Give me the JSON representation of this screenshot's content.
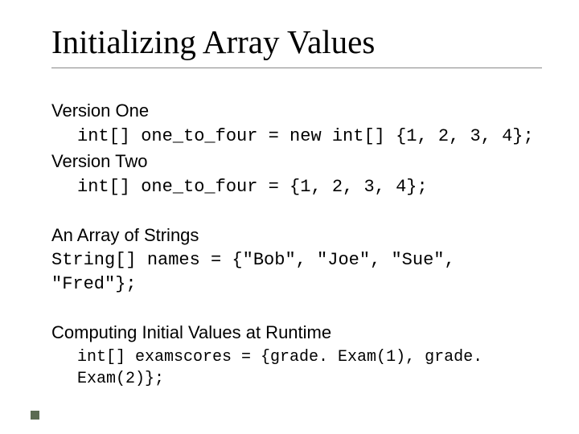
{
  "title": "Initializing Array Values",
  "v1_label": "Version One",
  "v1_code": "int[] one_to_four = new int[] {1, 2, 3, 4};",
  "v2_label": "Version Two",
  "v2_code": "int[] one_to_four = {1, 2, 3, 4};",
  "strings_label": "An Array of Strings",
  "strings_code": "String[] names = {\"Bob\", \"Joe\", \"Sue\", \"Fred\"};",
  "runtime_label": "Computing Initial Values at Runtime",
  "runtime_code": "int[] examscores = {grade. Exam(1), grade. Exam(2)};"
}
